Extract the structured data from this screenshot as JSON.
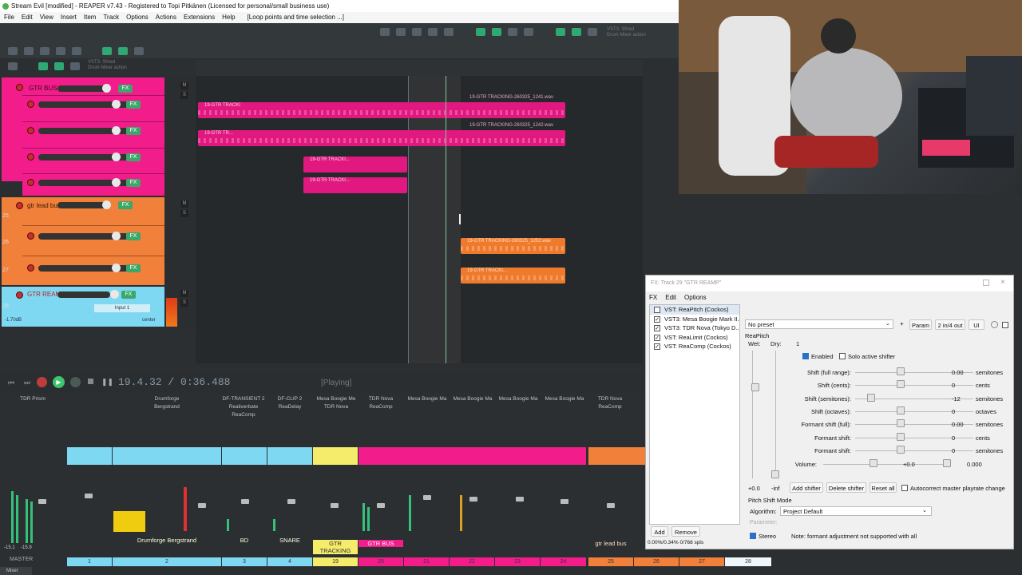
{
  "window": {
    "title": "Stream Evil [modified] - REAPER v7.43 - Registered to Topi Pitkänen (Licensed for personal/small business use)"
  },
  "menu": {
    "items": [
      "File",
      "Edit",
      "View",
      "Insert",
      "Item",
      "Track",
      "Options",
      "Actions",
      "Extensions",
      "Help"
    ],
    "loop_label": "[Loop points and time selection ...]"
  },
  "toolbar": {
    "plugin_hint": "VST3: Shred\nDrum Mixer action"
  },
  "tracks": [
    {
      "num": "",
      "name": "GTR BUS",
      "color": "#f21d8b"
    },
    {
      "num": "",
      "name": "",
      "color": "#f21d8b"
    },
    {
      "num": "",
      "name": "",
      "color": "#f21d8b"
    },
    {
      "num": "",
      "name": "",
      "color": "#f21d8b"
    },
    {
      "num": "",
      "name": "",
      "color": "#f21d8b"
    },
    {
      "num": "25",
      "name": "gtr lead bus",
      "color": "#f0803a"
    },
    {
      "num": "26",
      "name": "",
      "color": "#f0803a"
    },
    {
      "num": "27",
      "name": "",
      "color": "#f0803a"
    },
    {
      "num": "28",
      "name": "GTR REAMP",
      "color": "#7fd8f2",
      "volume": "-1.70dB",
      "pan": "center",
      "input": "Input 1"
    }
  ],
  "fx_badge": "FX",
  "clips": {
    "gtr_tracking_1": "19-GTR TRACKI",
    "gtr_tracking_2": "19-GTR TR...",
    "gtr_tracking_long_1": "19-GTR TRACKING-260325_1241.wav",
    "gtr_tracking_long_2": "19-GTR TRACKING-260325_1242.wav",
    "gtr_tracking_long_3": "19-GTR TRACKING-260325_1252.wav",
    "gtr_tracking_3": "19-GTR TRACKI...",
    "gtr_tracking_4": "19-GTR TRACKI..."
  },
  "transport": {
    "time": "19.4.32 / 0:36.488",
    "state": "[Playing]"
  },
  "mixer": {
    "fx_columns": [
      {
        "line1": "TDR Prism",
        "line2": "",
        "line3": ""
      },
      {
        "line1": "Drumforge Bergstrand",
        "line2": "",
        "line3": ""
      },
      {
        "line1": "DF-TRANSIENT 2",
        "line2": "Realiverbate",
        "line3": "ReaComp"
      },
      {
        "line1": "DF-CLIP 2",
        "line2": "ReaDelay",
        "line3": ""
      },
      {
        "line1": "Mesa Boogie Me",
        "line2": "TDR Nova",
        "line3": ""
      },
      {
        "line1": "TDR Nova",
        "line2": "ReaComp",
        "line3": ""
      },
      {
        "line1": "Mesa Boogie Ma",
        "line2": "",
        "line3": ""
      },
      {
        "line1": "Mesa Boogie Ma",
        "line2": "",
        "line3": ""
      },
      {
        "line1": "Mesa Boogie Ma",
        "line2": "",
        "line3": ""
      },
      {
        "line1": "Mesa Boogie Ma",
        "line2": "",
        "line3": ""
      },
      {
        "line1": "TDR Nova",
        "line2": "ReaComp",
        "line3": ""
      }
    ],
    "strip_names": [
      "Drumforge Bergstrand",
      "BD",
      "SNARE",
      "GTR TRACKING",
      "GTR BUS",
      "gtr lead bus"
    ],
    "strip_numbers": [
      "1",
      "2",
      "3",
      "4",
      "19",
      "20",
      "21",
      "22",
      "23",
      "24",
      "25",
      "26",
      "27",
      "28"
    ],
    "master_label": "MASTER",
    "master_levels": [
      "-15.1",
      "-15.9"
    ],
    "mixer_tab": "Mixer"
  },
  "fx_window": {
    "title": "FX: Track 29 \"GTR REAMP\"",
    "menu": [
      "FX",
      "Edit",
      "Options"
    ],
    "fx_list": [
      {
        "name": "VST: ReaPitch (Cockos)",
        "enabled": false,
        "selected": true
      },
      {
        "name": "VST3: Mesa Boogie Mark II...",
        "enabled": true,
        "selected": false
      },
      {
        "name": "VST3: TDR Nova (Tokyo D...",
        "enabled": true,
        "selected": false
      },
      {
        "name": "VST: ReaLimit (Cockos)",
        "enabled": true,
        "selected": false
      },
      {
        "name": "VST: ReaComp (Cockos)",
        "enabled": true,
        "selected": false
      }
    ],
    "preset": "No preset",
    "param_btn": "Param",
    "io_btn": "2 in/4 out",
    "ui_btn": "UI",
    "plugin_name": "ReaPitch",
    "wet_label": "Wet:",
    "dry_label": "Dry:",
    "dry_value": "1",
    "enabled_label": "Enabled",
    "solo_label": "Solo active shifter",
    "params": [
      {
        "label": "Shift (full range):",
        "value": "0.00",
        "unit": "semitones"
      },
      {
        "label": "Shift (cents):",
        "value": "0",
        "unit": "cents"
      },
      {
        "label": "Shift (semitones):",
        "value": "-12",
        "unit": "semitones"
      },
      {
        "label": "Shift (octaves):",
        "value": "0",
        "unit": "octaves"
      },
      {
        "label": "Formant shift (full):",
        "value": "0.00",
        "unit": "semitones"
      },
      {
        "label": "Formant shift:",
        "value": "0",
        "unit": "cents"
      },
      {
        "label": "Formant shift:",
        "value": "0",
        "unit": "semitones"
      }
    ],
    "volume_label": "Volume:",
    "volume_value": "+0.0",
    "volume_right": "0.000",
    "wet_value": "+0.0",
    "dry_bottom": "-inf",
    "add_shifter": "Add shifter",
    "delete_shifter": "Delete shifter",
    "reset_all": "Reset all",
    "autocorrect_label": "Autocorrect master playrate change",
    "pitch_mode_label": "Pitch Shift Mode",
    "algorithm_label": "Algorithm:",
    "algorithm_value": "Project Default",
    "parameter_label": "Parameter:",
    "stereo_label": "Stereo",
    "formant_note": "Note: formant adjustment not supported with all",
    "add_btn": "Add",
    "remove_btn": "Remove",
    "cpu": "0.00%/0.34% 0/768 spls"
  }
}
